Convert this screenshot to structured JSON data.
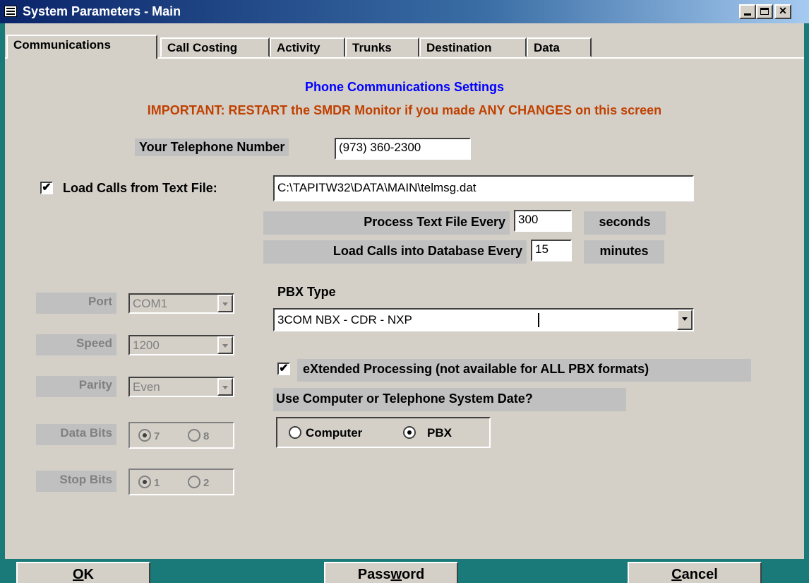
{
  "window": {
    "title": "System Parameters - Main"
  },
  "tabs": [
    {
      "label": "Communications"
    },
    {
      "label": "Call Costing"
    },
    {
      "label": "Activity"
    },
    {
      "label": "Trunks"
    },
    {
      "label": "Destination"
    },
    {
      "label": "Data"
    }
  ],
  "headings": {
    "title": "Phone Communications Settings",
    "warning": "IMPORTANT:  RESTART the SMDR Monitor if you made ANY CHANGES on this screen"
  },
  "telephone": {
    "label": "Your Telephone Number",
    "value": "(973) 360-2300"
  },
  "load_calls": {
    "checked": true,
    "check_mark": "✔",
    "label": "Load Calls from Text File:",
    "path": "C:\\TAPITW32\\DATA\\MAIN\\telmsg.dat"
  },
  "process_text": {
    "label": "Process Text File Every",
    "value": "300",
    "unit": "seconds"
  },
  "load_db": {
    "label": "Load Calls into Database Every",
    "value": "15",
    "unit": "minutes"
  },
  "serial": {
    "port_label": "Port",
    "port_value": "COM1",
    "speed_label": "Speed",
    "speed_value": "1200",
    "parity_label": "Parity",
    "parity_value": "Even",
    "databits_label": "Data Bits",
    "databits_opt1": "7",
    "databits_opt2": "8",
    "stopbits_label": "Stop Bits",
    "stopbits_opt1": "1",
    "stopbits_opt2": "2"
  },
  "pbx": {
    "label": "PBX Type",
    "value": "3COM NBX - CDR - NXP"
  },
  "extended": {
    "checked": true,
    "check_mark": "✔",
    "label": "eXtended Processing  (not available for ALL PBX formats)"
  },
  "date_source": {
    "question": "Use Computer or Telephone System Date?",
    "opt_computer": "Computer",
    "opt_pbx": "PBX",
    "selected": "PBX"
  },
  "buttons": {
    "ok_pre": "",
    "ok_u": "O",
    "ok_post": "K",
    "pw_pre": "Pass",
    "pw_u": "w",
    "pw_post": "ord",
    "cancel_pre": "",
    "cancel_u": "C",
    "cancel_post": "ancel"
  },
  "icons": [
    "window-menu-icon",
    "minimize-icon",
    "maximize-icon",
    "close-icon",
    "dropdown-arrow-icon"
  ]
}
